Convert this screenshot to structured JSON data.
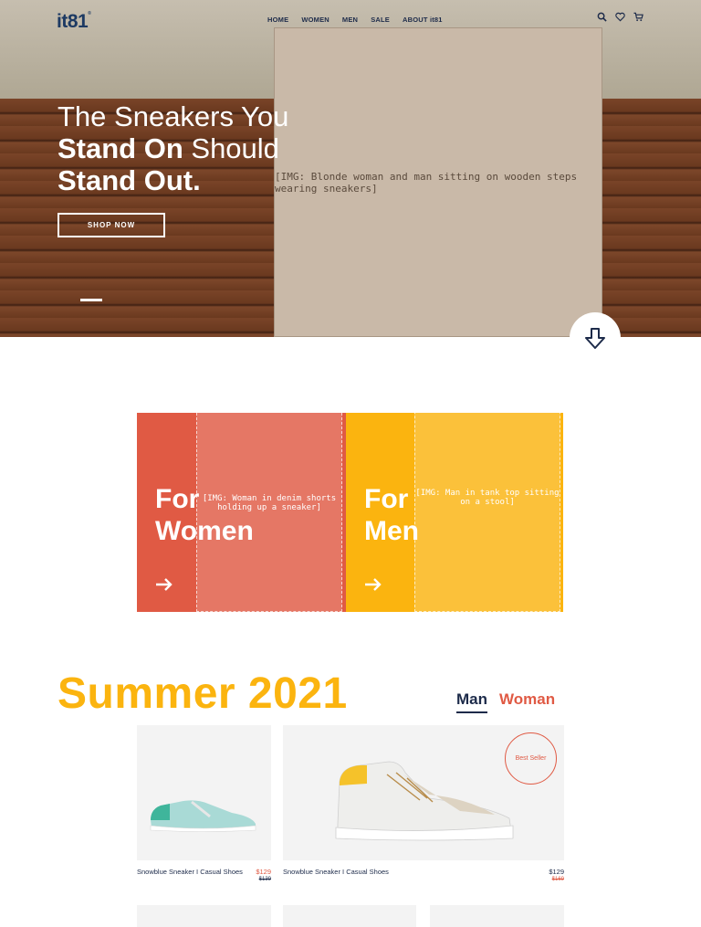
{
  "brand": {
    "logo": "it81"
  },
  "nav": {
    "items": [
      "HOME",
      "WOMEN",
      "MEN",
      "SALE",
      "ABOUT it81"
    ]
  },
  "icons": [
    "search-icon",
    "heart-icon",
    "cart-icon",
    "arrow-down-icon",
    "arrow-right-icon"
  ],
  "hero": {
    "headline_line1": "The Sneakers You",
    "headline_line2_bold": "Stand On",
    "headline_line2_rest": " Should",
    "headline_line3_bold": "Stand Out.",
    "cta": "SHOP NOW",
    "image_label": "[IMG: Blonde woman and man sitting on wooden steps wearing sneakers]"
  },
  "categories": [
    {
      "title_line1": "For",
      "title_line2": "Women",
      "color": "#e05a44",
      "image_label": "[IMG: Woman in denim shorts holding up a sneaker]"
    },
    {
      "title_line1": "For",
      "title_line2": "Men",
      "color": "#fbb40f",
      "image_label": "[IMG: Man in tank top sitting on a stool]"
    }
  ],
  "summer": {
    "title": "Summer 2021",
    "tabs": [
      {
        "label": "Man",
        "active": true
      },
      {
        "label": "Woman",
        "active": false
      }
    ]
  },
  "products": [
    {
      "name": "Snowblue Sneaker I Casual Shoes",
      "price": "$129",
      "old_price": "$139",
      "price_color": "#e05a44"
    },
    {
      "name": "Snowblue Sneaker I Casual Shoes",
      "price": "$129",
      "old_price": "$169",
      "price_color": "#1d2b4a",
      "badge": "Best Seller"
    }
  ],
  "colors": {
    "navy": "#1d2b4a",
    "coral": "#e05a44",
    "yellow": "#fbb40f",
    "card_bg": "#f3f3f3"
  }
}
